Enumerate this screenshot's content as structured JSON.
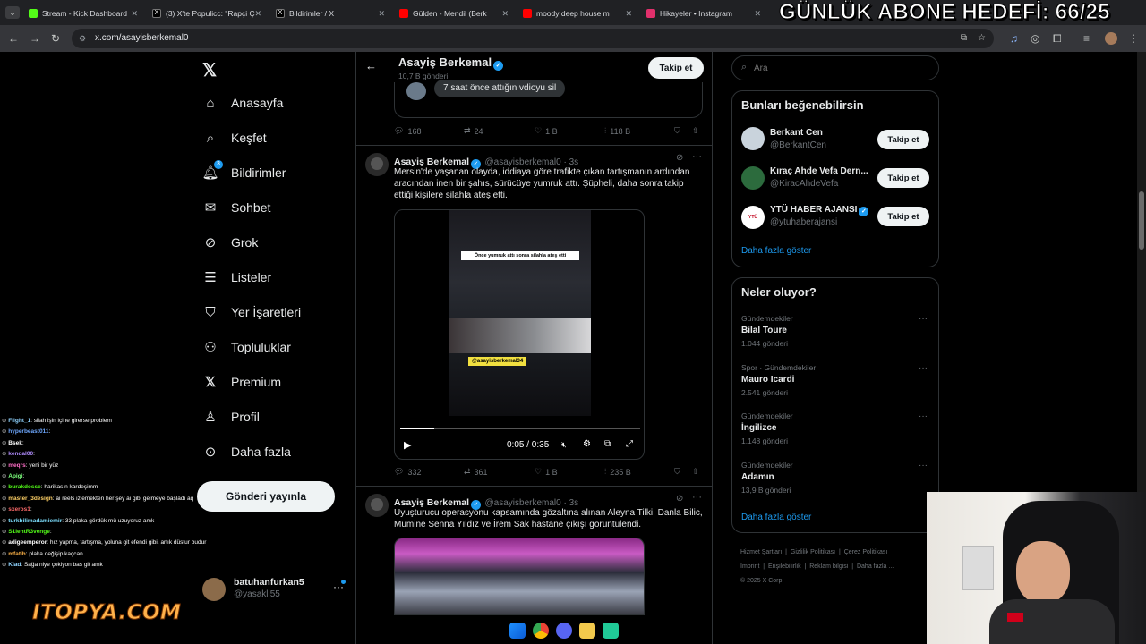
{
  "overlay": {
    "title": "GÜNLÜK ABONE HEDEFİ: 66/25"
  },
  "browser": {
    "tabs": [
      {
        "label": "Stream - Kick Dashboard",
        "color": "#53fc18"
      },
      {
        "label": "(3) X'te Populicc: \"Rapçi Ç",
        "color": "#ffffff"
      },
      {
        "label": "Bildirimler / X",
        "color": "#ffffff"
      },
      {
        "label": "Gülden - Mendil (Berk",
        "color": "#ff0000"
      },
      {
        "label": "moody deep house m",
        "color": "#ff0000"
      },
      {
        "label": "Hikayeler • Instagram",
        "color": "#e1306c"
      }
    ],
    "url": "x.com/asayisberkemal0"
  },
  "sidebar": {
    "items": [
      {
        "label": "Anasayfa",
        "icon": "home-icon"
      },
      {
        "label": "Keşfet",
        "icon": "search-icon"
      },
      {
        "label": "Bildirimler",
        "icon": "bell-icon",
        "badge": "3"
      },
      {
        "label": "Sohbet",
        "icon": "mail-icon"
      },
      {
        "label": "Grok",
        "icon": "grok-icon"
      },
      {
        "label": "Listeler",
        "icon": "list-icon"
      },
      {
        "label": "Yer İşaretleri",
        "icon": "bookmark-icon"
      },
      {
        "label": "Topluluklar",
        "icon": "communities-icon"
      },
      {
        "label": "Premium",
        "icon": "x-logo-icon"
      },
      {
        "label": "Profil",
        "icon": "person-icon"
      },
      {
        "label": "Daha fazla",
        "icon": "more-circle-icon"
      }
    ],
    "post_button": "Gönderi yayınla",
    "account": {
      "name": "batuhanfurkan5",
      "handle": "@yasakli55"
    }
  },
  "profile_header": {
    "name": "Asayiş Berkemal",
    "posts": "10,7 B gönderi",
    "follow": "Takip et"
  },
  "quoted_reply": {
    "text": "7 saat önce attığın vdioyu sil"
  },
  "tweets": [
    {
      "stats": {
        "replies": "168",
        "retweets": "24",
        "likes": "1 B",
        "views": "118 B"
      }
    },
    {
      "name": "Asayiş Berkemal",
      "handle": "@asayisberkemal0",
      "time": "3s",
      "text": "Mersin'de yaşanan olayda, iddiaya göre trafikte çıkan tartışmanın ardından aracından inen bir şahıs, sürücüye yumruk attı. Şüpheli, daha sonra takip ettiği kişilere silahla ateş etti.",
      "video": {
        "caption": "Önce yumruk attı sonra silahla ateş etti",
        "watermark": "@asayisberkemal34",
        "time": "0:05 / 0:35",
        "progress": 0.14
      },
      "stats": {
        "replies": "332",
        "retweets": "361",
        "likes": "1 B",
        "views": "235 B"
      }
    },
    {
      "name": "Asayiş Berkemal",
      "handle": "@asayisberkemal0",
      "time": "3s",
      "text": "Uyuşturucu operasyonu kapsamında gözaltına alınan Aleyna Tilki, Danla Bilic, Mümine Senna Yıldız ve İrem Sak hastane çıkışı görüntülendi."
    }
  ],
  "search": {
    "placeholder": "Ara"
  },
  "suggestions": {
    "title": "Bunları beğenebilirsin",
    "items": [
      {
        "name": "Berkant Cen",
        "handle": "@BerkantCen",
        "button": "Takip et"
      },
      {
        "name": "Kıraç Ahde Vefa Dern...",
        "handle": "@KiracAhdeVefa",
        "button": "Takip et"
      },
      {
        "name": "YTÜ HABER AJANSI",
        "handle": "@ytuhaberajansi",
        "button": "Takip et"
      }
    ],
    "more": "Daha fazla göster"
  },
  "trends": {
    "title": "Neler oluyor?",
    "items": [
      {
        "category": "Gündemdekiler",
        "title": "Bilal Toure",
        "count": "1.044 gönderi"
      },
      {
        "category": "Spor · Gündemdekiler",
        "title": "Mauro Icardi",
        "count": "2.541 gönderi"
      },
      {
        "category": "Gündemdekiler",
        "title": "İngilizce",
        "count": "1.148 gönderi"
      },
      {
        "category": "Gündemdekiler",
        "title": "Adamın",
        "count": "13,9 B gönderi"
      }
    ],
    "more": "Daha fazla göster"
  },
  "footer": {
    "links": [
      "Hizmet Şartları",
      "Gizlilik Politikası",
      "Çerez Politikası",
      "Imprint",
      "Erişilebilirlik",
      "Reklam bilgisi",
      "Daha fazla ..."
    ],
    "copyright": "© 2025 X Corp."
  },
  "chat": [
    {
      "user": "Flight_1",
      "msg": ": silah işin içine girerse problem",
      "color": "#8fd3ff"
    },
    {
      "user": "hyperbeast011",
      "msg": ":",
      "color": "#6ea8ff"
    },
    {
      "user": "Bsek",
      "msg": ":",
      "color": "#ffffff"
    },
    {
      "user": "kendal00",
      "msg": ":",
      "color": "#b18cff"
    },
    {
      "user": "meqrs",
      "msg": ": yeni bir yüz",
      "color": "#ff6ec7"
    },
    {
      "user": "Apigi",
      "msg": ":",
      "color": "#7dff7d"
    },
    {
      "user": "burakdosse",
      "msg": ": harikasın kardeşimm",
      "color": "#53fc18"
    },
    {
      "user": "master_3design",
      "msg": ": ai reels izlemekten her şey ai gibi gelmeye başladı aq",
      "color": "#ffd166"
    },
    {
      "user": "sxeros1",
      "msg": ":",
      "color": "#ff6b6b"
    },
    {
      "user": "turkbilimadamiemir",
      "msg": ": 33 plaka gördük mü uzuyoruz amk",
      "color": "#7ee0ff"
    },
    {
      "user": "S1lentR3venge",
      "msg": ":",
      "color": "#53fc18"
    },
    {
      "user": "adigeemperor",
      "msg": ": hız yapma, tartışma, yoluna git efendi gibi. artık düstur budur",
      "color": "#ffffff"
    },
    {
      "user": "mfatih",
      "msg": ": plaka değişip kaçcan",
      "color": "#ffb347"
    },
    {
      "user": "Klad",
      "msg": ": Sağa niye çekiyon bas git amk",
      "color": "#8fd3ff"
    }
  ],
  "branding": {
    "logo": "ITOPYA.COM"
  },
  "colors": {
    "accent": "#1d9bf0",
    "kick": "#53fc18"
  }
}
